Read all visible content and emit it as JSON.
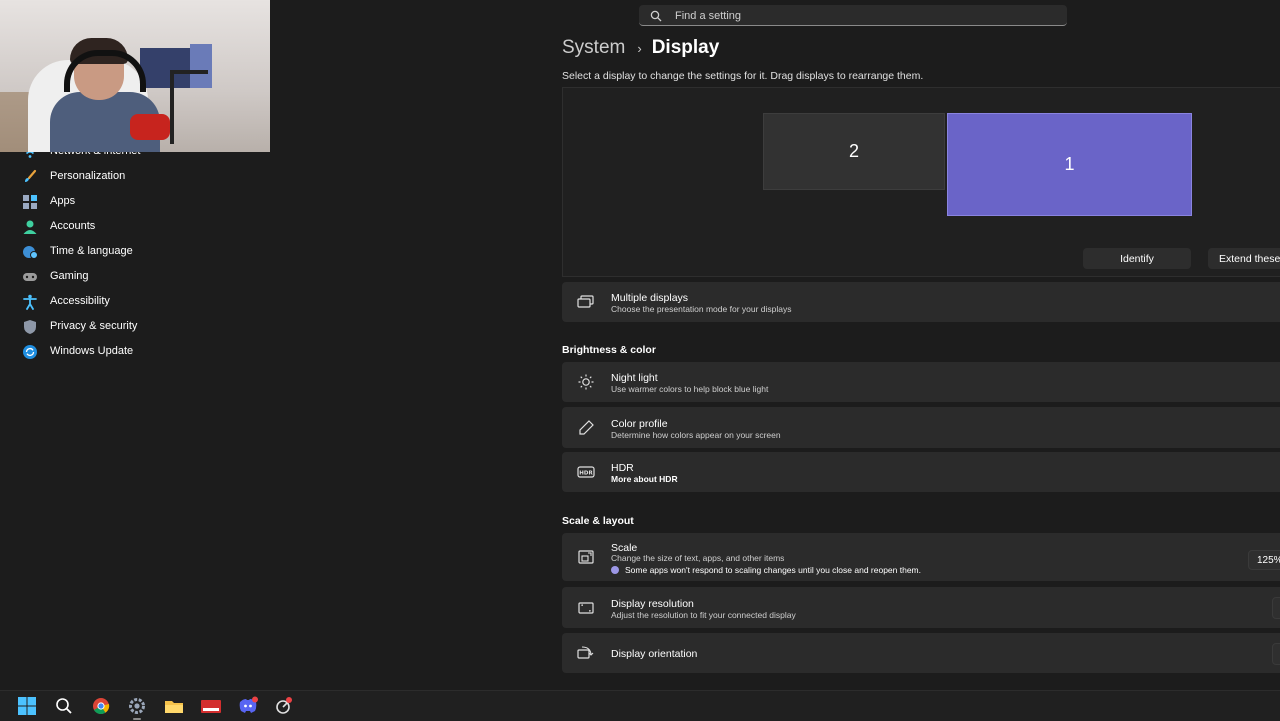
{
  "search": {
    "placeholder": "Find a setting"
  },
  "breadcrumb": {
    "parent": "System",
    "separator": "›",
    "current": "Display"
  },
  "instructions": "Select a display to change the settings for it. Drag displays to rearrange them.",
  "arrangement": {
    "monitors": [
      "2",
      "1"
    ],
    "identify_label": "Identify",
    "extend_label": "Extend these",
    "selected_color": "#6a64c8"
  },
  "sidebar": {
    "items": [
      {
        "label": "Network & internet",
        "icon": "wifi-icon"
      },
      {
        "label": "Personalization",
        "icon": "brush-icon"
      },
      {
        "label": "Apps",
        "icon": "apps-icon"
      },
      {
        "label": "Accounts",
        "icon": "person-icon"
      },
      {
        "label": "Time & language",
        "icon": "globe-clock-icon"
      },
      {
        "label": "Gaming",
        "icon": "gamepad-icon"
      },
      {
        "label": "Accessibility",
        "icon": "accessibility-icon"
      },
      {
        "label": "Privacy & security",
        "icon": "shield-icon"
      },
      {
        "label": "Windows Update",
        "icon": "update-icon"
      }
    ]
  },
  "multiple_displays": {
    "title": "Multiple displays",
    "subtitle": "Choose the presentation mode for your displays"
  },
  "brightness": {
    "section_title": "Brightness & color",
    "night_light": {
      "title": "Night light",
      "subtitle": "Use warmer colors to help block blue light"
    },
    "color_profile": {
      "title": "Color profile",
      "subtitle": "Determine how colors appear on your screen"
    },
    "hdr": {
      "title": "HDR",
      "link": "More about HDR"
    }
  },
  "scale_layout": {
    "section_title": "Scale & layout",
    "scale": {
      "title": "Scale",
      "subtitle": "Change the size of text, apps, and other items",
      "note": "Some apps won't respond to scaling changes until you close and reopen them.",
      "value": "125%"
    },
    "resolution": {
      "title": "Display resolution",
      "subtitle": "Adjust the resolution to fit your connected display"
    },
    "orientation": {
      "title": "Display orientation"
    }
  },
  "taskbar": {
    "items": [
      "windows-start-icon",
      "search-icon",
      "chrome-icon",
      "settings-icon",
      "file-explorer-icon",
      "voicemeeter-icon",
      "discord-icon",
      "snipping-icon"
    ]
  }
}
